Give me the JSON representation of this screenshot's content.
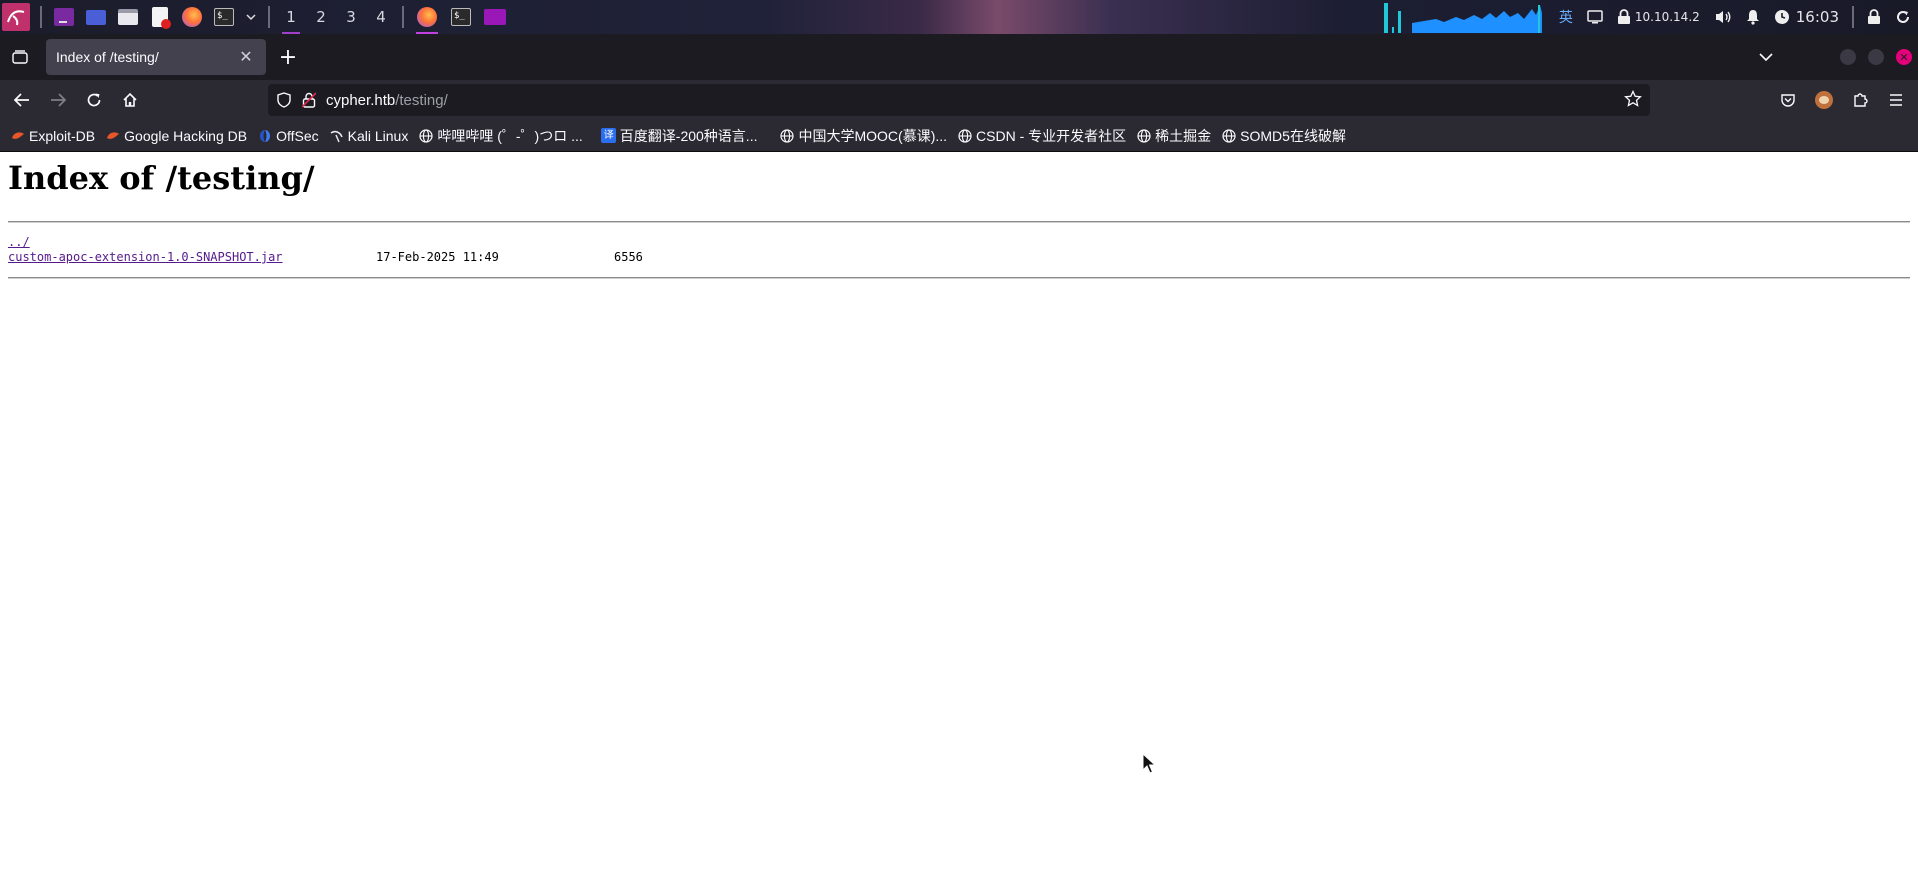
{
  "taskbar": {
    "workspaces": [
      "1",
      "2",
      "3",
      "4"
    ],
    "active_workspace": "1",
    "tray": {
      "input_method": "英",
      "ip": "10.10.14.2",
      "clock": "16:03"
    }
  },
  "browser": {
    "tab": {
      "title": "Index of /testing/"
    },
    "url": {
      "host": "cypher.htb",
      "path": "/testing/"
    },
    "bookmarks": [
      {
        "label": "Exploit-DB",
        "icon": "exploit-db-icon"
      },
      {
        "label": "Google Hacking DB",
        "icon": "ghdb-icon"
      },
      {
        "label": "OffSec",
        "icon": "offsec-icon"
      },
      {
        "label": "Kali Linux",
        "icon": "kali-icon"
      },
      {
        "label": "哔哩哔哩 (゜-゜)つロ ...",
        "icon": "globe-icon"
      },
      {
        "label": "百度翻译-200种语言...",
        "icon": "baidu-translate-icon"
      },
      {
        "label": "中国大学MOOC(慕课)...",
        "icon": "globe-icon"
      },
      {
        "label": "CSDN - 专业开发者社区",
        "icon": "globe-icon"
      },
      {
        "label": "稀土掘金",
        "icon": "globe-icon"
      },
      {
        "label": "SOMD5在线破解",
        "icon": "globe-icon"
      }
    ]
  },
  "page": {
    "heading": "Index of /testing/",
    "parent_link": "../",
    "files": [
      {
        "name": "custom-apoc-extension-1.0-SNAPSHOT.jar",
        "date": "17-Feb-2025 11:49",
        "size": "6556"
      }
    ]
  },
  "colors": {
    "browser_chrome": "#2b2a33",
    "tabstrip": "#1c1b22",
    "active_tab": "#42414d",
    "visited_link": "#551a8b",
    "accent_purple": "#a040c8"
  }
}
